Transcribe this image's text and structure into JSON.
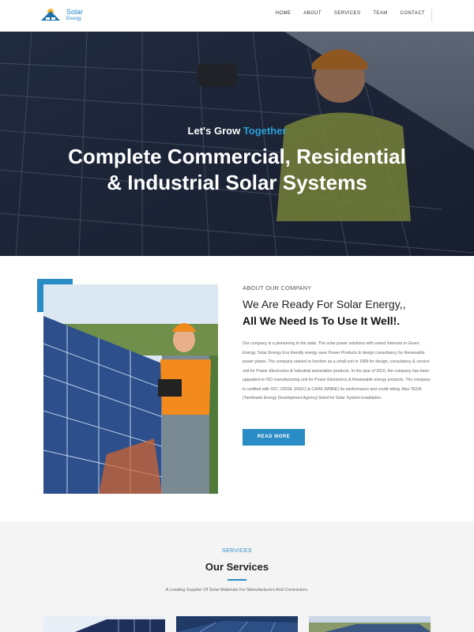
{
  "header": {
    "logo": {
      "line1": "Solar",
      "line2": "Energy"
    },
    "nav": [
      {
        "label": "HOME"
      },
      {
        "label": "ABOUT"
      },
      {
        "label": "SERVICES"
      },
      {
        "label": "TEAM"
      },
      {
        "label": "CONTACT"
      }
    ]
  },
  "hero": {
    "tagline_part1": "Let's Grow ",
    "tagline_highlight": "Together",
    "title": "Complete Commercial, Residential & Industrial Solar Systems"
  },
  "about": {
    "label": "ABOUT OUR COMPANY",
    "heading_line1": "We Are Ready For Solar Energy,,",
    "heading_line2": "All We Need Is To Use It Well!.",
    "body": "Our company is a pioneering in the state. The solar power solutions with varied interests in Green Energy. Solar Energy Eco friendly energy save Power Products & design consultancy for Renewable power plants. The company started to function as a small unit in 1999 for design, consultancy & service unit for Power Electronics & Industrial automation products. In the year of 2010, the company has been upgraded to ISO manufacturing unit for Power Electronics & Renewable energy products. The company is certified with ISO, CRISIL (NSIC) & CARE (MNRE) for performance and credit rating. Also TEDA (Tamilnadu Energy Development Agency) listed for Solar System installation.",
    "button": "READ MORE"
  },
  "services": {
    "label": "SERVICES",
    "title": "Our Services",
    "subtitle": "A Leading Supplier Of Solar Materials For Manufacturers And Contractors."
  },
  "colors": {
    "accent": "#2a8cc4",
    "highlight": "#2a9fd6",
    "section_bg": "#f4f4f4"
  }
}
